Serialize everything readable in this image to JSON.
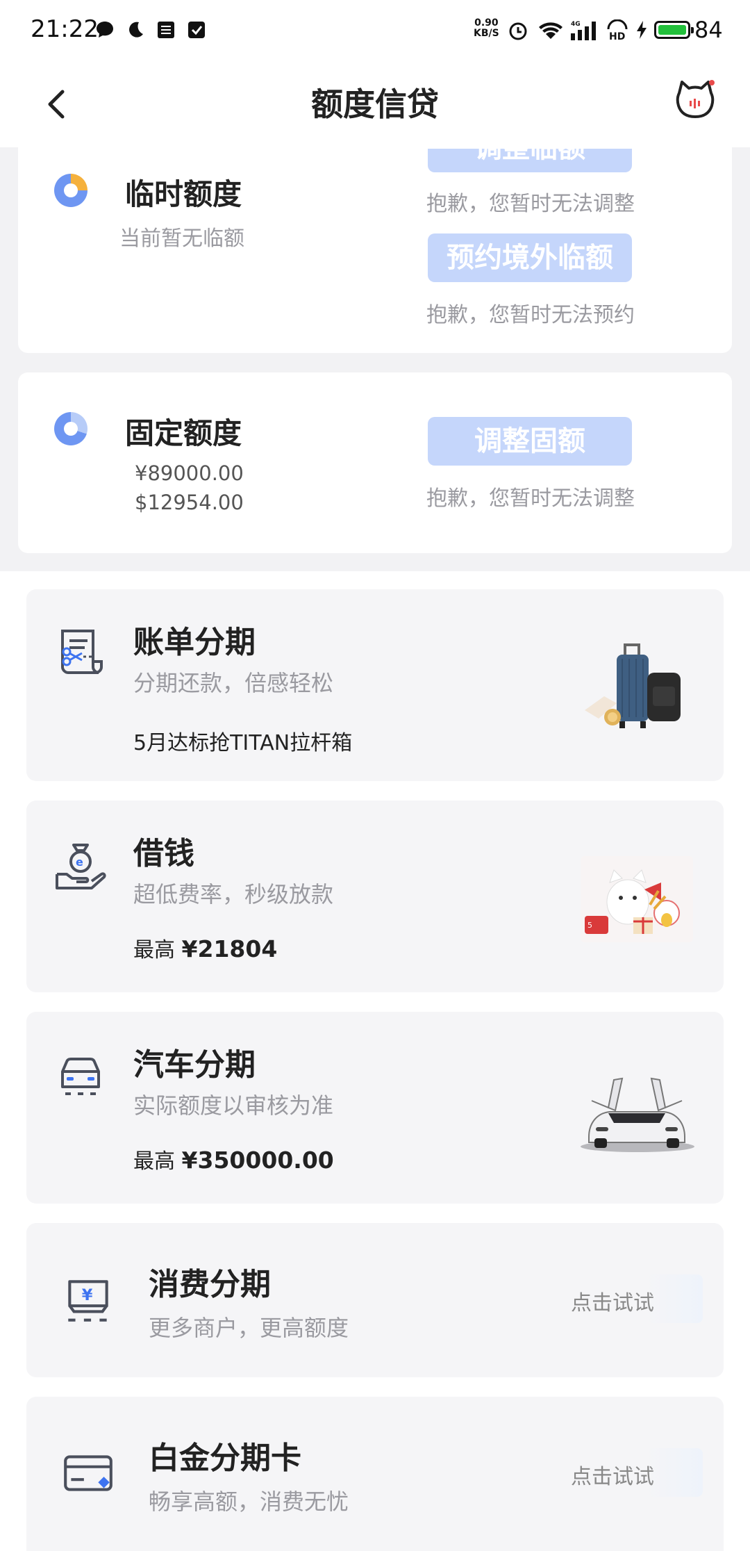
{
  "status_bar": {
    "time": "21:22",
    "net_speed_value": "0.90",
    "net_speed_unit": "KB/S",
    "network": "4G",
    "hd": "HD",
    "battery": "84",
    "battery_color": "#22c03b"
  },
  "nav": {
    "title": "额度信贷",
    "back_icon": "chevron-left-icon",
    "service_icon": "cat-service-icon"
  },
  "temp_quota": {
    "title": "临时额度",
    "subtitle": "当前暂无临额",
    "button1_label": "调整临额",
    "button1_hint": "抱歉，您暂时无法调整",
    "button2_label": "预约境外临额",
    "button2_hint": "抱歉，您暂时无法预约"
  },
  "fixed_quota": {
    "title": "固定额度",
    "amount_cny": "¥89000.00",
    "amount_usd": "$12954.00",
    "button_label": "调整固额",
    "button_hint": "抱歉，您暂时无法调整"
  },
  "products": [
    {
      "title": "账单分期",
      "subtitle": "分期还款，倍感轻松",
      "extra": "5月达标抢TITAN拉杆箱",
      "icon": "bill-installment-icon"
    },
    {
      "title": "借钱",
      "subtitle": "超低费率，秒级放款",
      "extra_prefix": "最高 ",
      "extra_value": "¥21804",
      "icon": "money-bag-hand-icon"
    },
    {
      "title": "汽车分期",
      "subtitle": "实际额度以审核为准",
      "extra_prefix": "最高 ",
      "extra_value": "¥350000.00",
      "icon": "car-icon"
    },
    {
      "title": "消费分期",
      "subtitle": "更多商户，更高额度",
      "action": "点击试试",
      "icon": "yen-box-icon"
    },
    {
      "title": "白金分期卡",
      "subtitle": "畅享高额，消费无忧",
      "action": "点击试试",
      "icon": "credit-card-icon"
    }
  ],
  "colors": {
    "accent_blue": "#6e96f2",
    "disabled_button": "#c5d6fb",
    "card_gray": "#f5f5f7"
  }
}
